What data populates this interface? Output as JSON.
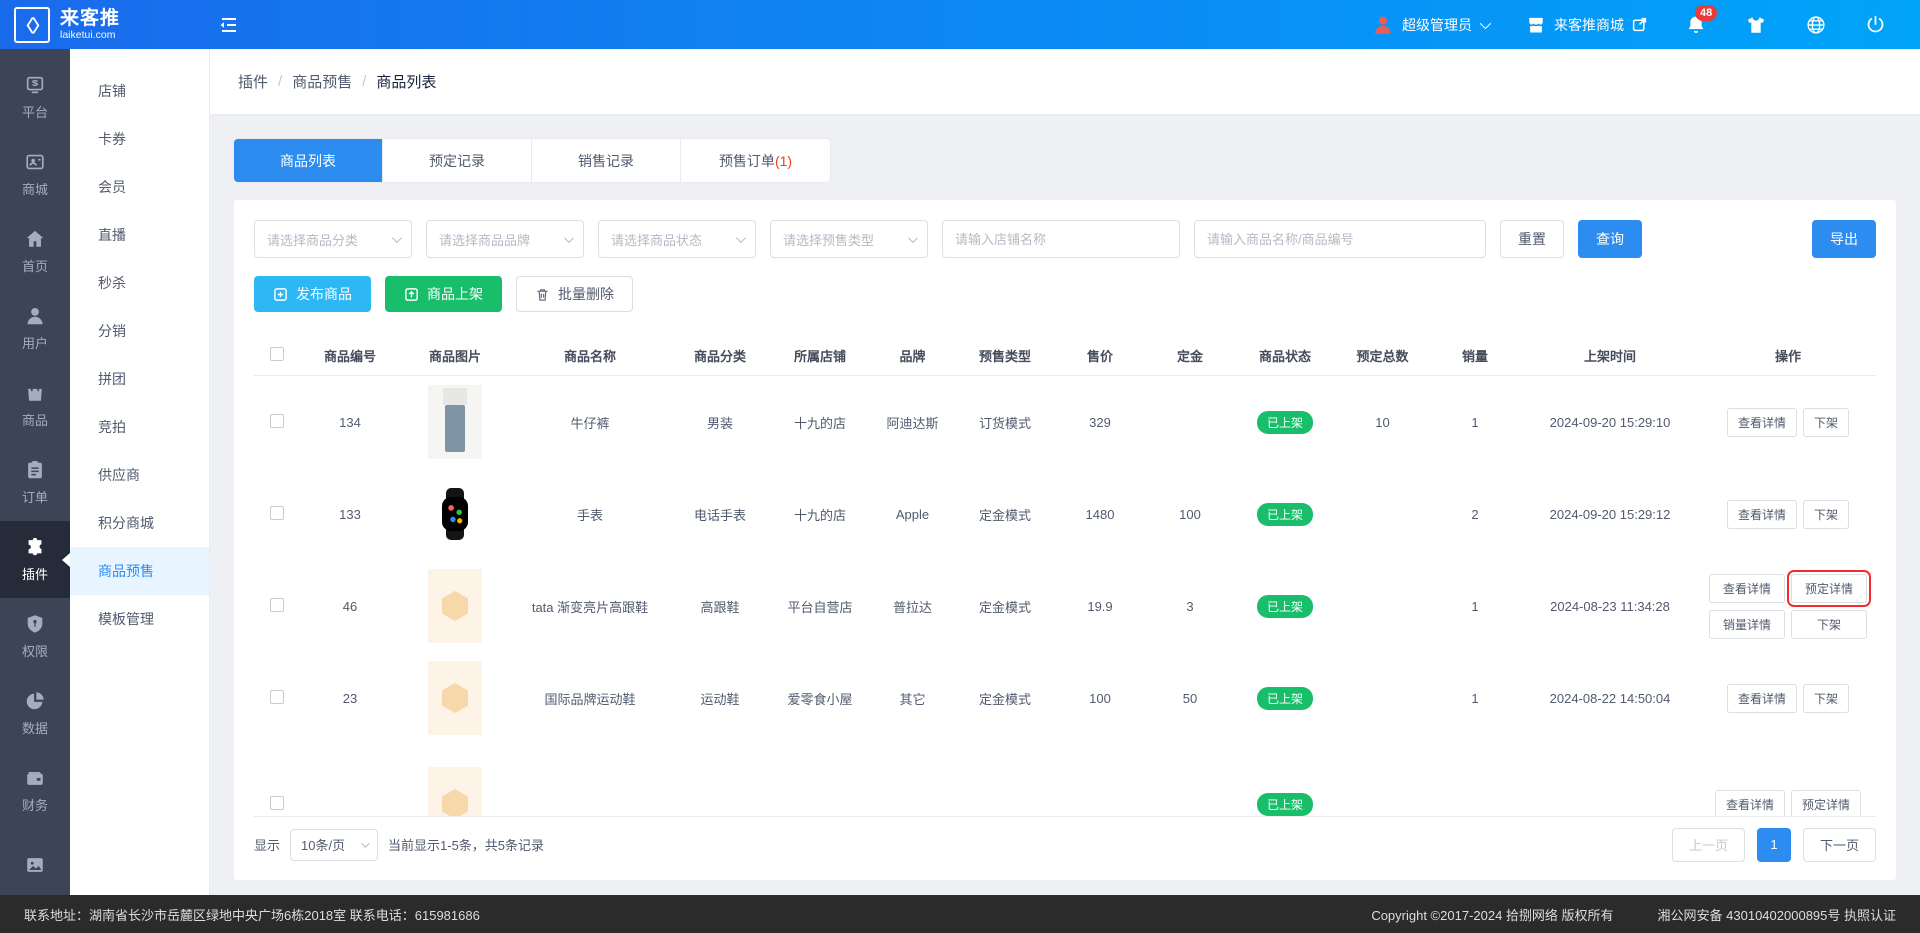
{
  "header": {
    "logo_mark": "〈〉",
    "logo_title": "来客推",
    "logo_domain": "laiketui.com",
    "user_name": "超级管理员",
    "mall_name": "来客推商城",
    "badge_count": "48"
  },
  "rail": {
    "items": [
      {
        "label": "平台"
      },
      {
        "label": "商城"
      },
      {
        "label": "首页"
      },
      {
        "label": "用户"
      },
      {
        "label": "商品"
      },
      {
        "label": "订单"
      },
      {
        "label": "插件"
      },
      {
        "label": "权限"
      },
      {
        "label": "数据"
      },
      {
        "label": "财务"
      },
      {
        "label": ""
      }
    ]
  },
  "sidebar": {
    "items": [
      "店铺",
      "卡券",
      "会员",
      "直播",
      "秒杀",
      "分销",
      "拼团",
      "竞拍",
      "供应商",
      "积分商城",
      "商品预售",
      "模板管理"
    ]
  },
  "breadcrumb": {
    "part1": "插件",
    "part2": "商品预售",
    "part3": "商品列表",
    "sep": "/"
  },
  "tabs": {
    "tab1": "商品列表",
    "tab2": "预定记录",
    "tab3": "销售记录",
    "tab4": "预售订单",
    "tab4_badge": "(1)"
  },
  "filters": {
    "category_placeholder": "请选择商品分类",
    "brand_placeholder": "请选择商品品牌",
    "status_placeholder": "请选择商品状态",
    "presale_placeholder": "请选择预售类型",
    "store_placeholder": "请输入店铺名称",
    "product_placeholder": "请输入商品名称/商品编号",
    "reset": "重置",
    "search": "查询",
    "export": "导出"
  },
  "toolbar": {
    "publish": "发布商品",
    "onshelf": "商品上架",
    "batch_delete": "批量删除"
  },
  "table": {
    "columns": {
      "c1": "商品编号",
      "c2": "商品图片",
      "c3": "商品名称",
      "c4": "商品分类",
      "c5": "所属店铺",
      "c6": "品牌",
      "c7": "预售类型",
      "c8": "售价",
      "c9": "定金",
      "c10": "商品状态",
      "c11": "预定总数",
      "c12": "销量",
      "c13": "上架时间",
      "c14": "操作"
    },
    "rows": [
      {
        "id": "134",
        "image": "jeans-photo",
        "name": "牛仔裤",
        "category": "男装",
        "store": "十九的店",
        "brand": "阿迪达斯",
        "presale_type": "订货模式",
        "price": "329",
        "deposit": "",
        "status": "已上架",
        "reserved": "10",
        "sales": "1",
        "time": "2024-09-20 15:29:10",
        "btn_view": "查看详情",
        "btn_off": "下架"
      },
      {
        "id": "133",
        "image": "watch-photo",
        "name": "手表",
        "category": "电话手表",
        "store": "十九的店",
        "brand": "Apple",
        "presale_type": "定金模式",
        "price": "1480",
        "deposit": "100",
        "status": "已上架",
        "reserved": "",
        "sales": "2",
        "time": "2024-09-20 15:29:12",
        "btn_view": "查看详情",
        "btn_off": "下架"
      },
      {
        "id": "46",
        "image": "placeholder",
        "name": "tata 渐变亮片高跟鞋",
        "category": "高跟鞋",
        "store": "平台自营店",
        "brand": "普拉达",
        "presale_type": "定金模式",
        "price": "19.9",
        "deposit": "3",
        "status": "已上架",
        "reserved": "",
        "sales": "1",
        "time": "2024-08-23 11:34:28",
        "btn_view": "查看详情",
        "btn_reserve": "预定详情",
        "btn_sales": "销量详情",
        "btn_off": "下架"
      },
      {
        "id": "23",
        "image": "placeholder",
        "name": "国际品牌运动鞋",
        "category": "运动鞋",
        "store": "爱零食小屋",
        "brand": "其它",
        "presale_type": "定金模式",
        "price": "100",
        "deposit": "50",
        "status": "已上架",
        "reserved": "",
        "sales": "1",
        "time": "2024-08-22 14:50:04",
        "btn_view": "查看详情",
        "btn_off": "下架"
      },
      {
        "id": "",
        "image": "placeholder",
        "name": "",
        "category": "",
        "store": "",
        "brand": "",
        "presale_type": "",
        "price": "",
        "deposit": "",
        "status": "已上架",
        "reserved": "",
        "sales": "",
        "time": "",
        "btn_view": "查看详情",
        "btn_reserve": "预定详情"
      }
    ]
  },
  "pagination": {
    "show": "显示",
    "page_size": "10条/页",
    "summary": "当前显示1-5条，共5条记录",
    "prev": "上一页",
    "page": "1",
    "next": "下一页"
  },
  "footer": {
    "address": "联系地址：湖南省长沙市岳麓区绿地中央广场6栋2018室 联系电话：615981686",
    "copyright": "Copyright ©2017-2024 拾捌网络 版权所有",
    "icp": "湘公网安备 43010402000895号 执照认证"
  },
  "colors": {
    "accent": "#2d8cf0",
    "info": "#2db7f5",
    "success": "#19be6b",
    "danger": "#ed4014",
    "header_start": "#1a6bec",
    "header_end": "#00a4f8",
    "rail_bg": "#3d4456",
    "footer_bg": "#2b2b2b"
  }
}
